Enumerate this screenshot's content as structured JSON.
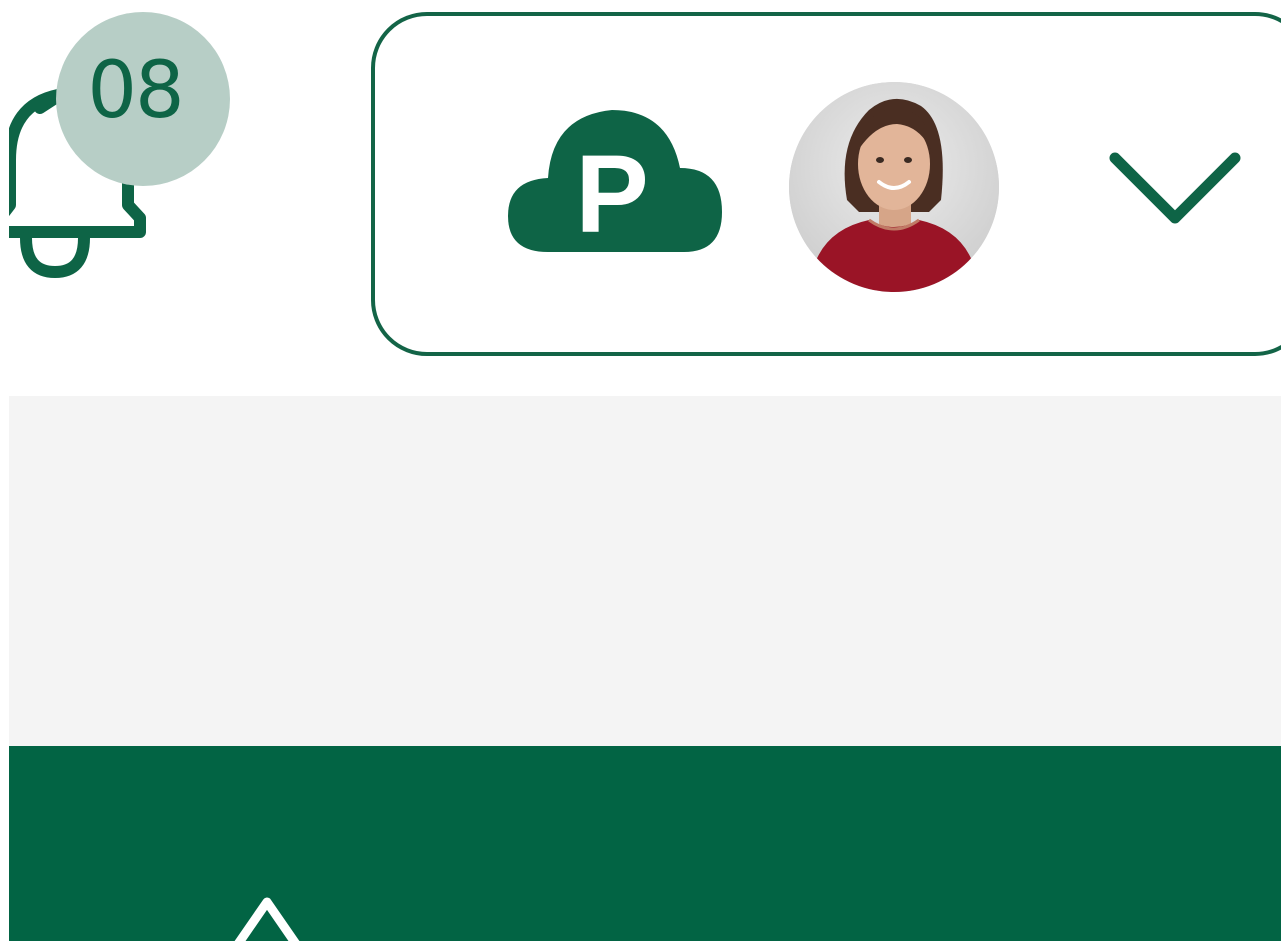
{
  "notifications": {
    "count_label": "08",
    "icon": "bell-icon"
  },
  "account_menu": {
    "logo_letter": "P",
    "logo_icon": "cloud-p-logo",
    "avatar_icon": "user-avatar",
    "dropdown_icon": "chevron-down-icon"
  },
  "nav_bar": {
    "icon": "chevron-up-icon"
  },
  "colors": {
    "brand_green": "#026444",
    "badge_bg": "#b7cec6",
    "band_gray": "#f4f4f4"
  }
}
